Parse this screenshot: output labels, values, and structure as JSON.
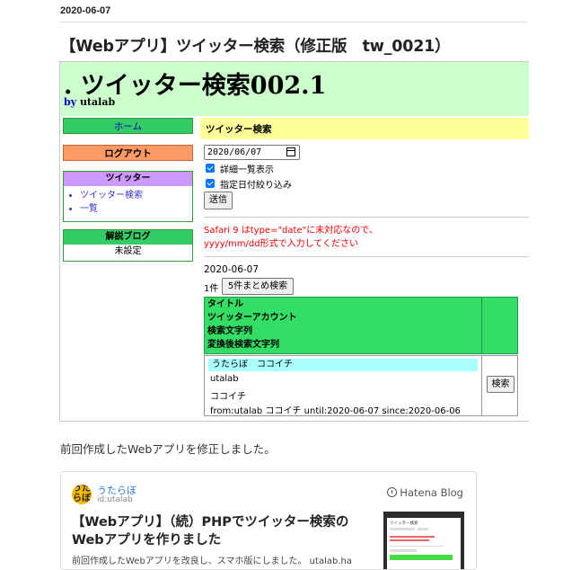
{
  "post": {
    "date": "2020-06-07",
    "title": "【Webアプリ】ツイッター検索（修正版　tw_0021）",
    "body": "前回作成したWebアプリを修正しました。"
  },
  "app": {
    "title": ". ツイッター検索002.1",
    "by_label": "by",
    "by_author": "utalab",
    "sidebar": {
      "home": "ホーム",
      "logout": "ログアウト",
      "twitter_box": {
        "heading": "ツイッター",
        "items": [
          "ツイッター検索",
          "一覧"
        ]
      },
      "blog_box": {
        "heading": "解説ブログ",
        "value": "未設定"
      }
    },
    "main": {
      "section_title": "ツイッター検索",
      "date_value": "2020/06/07",
      "checkbox_detail": "詳細一覧表示",
      "checkbox_date": "指定日付絞り込み",
      "send_button": "送信",
      "warning_line1": "Safari 9 はtype=\"date\"に未対応なので、",
      "warning_line2": "yyyy/mm/dd形式で入力してください",
      "result_date": "2020-06-07",
      "result_count": "1件",
      "batch_button": "5件まとめ検索",
      "headers": [
        "タイトル",
        "ツイッターアカウント",
        "検索文字列",
        "変換後検索文字列"
      ],
      "row": {
        "title": "うたらぼ　ココイチ",
        "account": "utalab",
        "keyword": "ココイチ",
        "converted": "from:utalab ココイチ until:2020-06-07 since:2020-06-06"
      },
      "search_button": "検索"
    }
  },
  "card": {
    "avatar_text": "うた\nらぼ",
    "blog_name": "うたらぼ",
    "blog_id": "id:utalab",
    "provider": "Hatena Blog",
    "title": "【Webアプリ】（続）PHPでツイッター検索のWebアプリを作りました",
    "description": "前回作成したWebアプリを改良し、スマホ版にしました。 utalab.ha",
    "thumb_title": "ツイッター検索"
  }
}
